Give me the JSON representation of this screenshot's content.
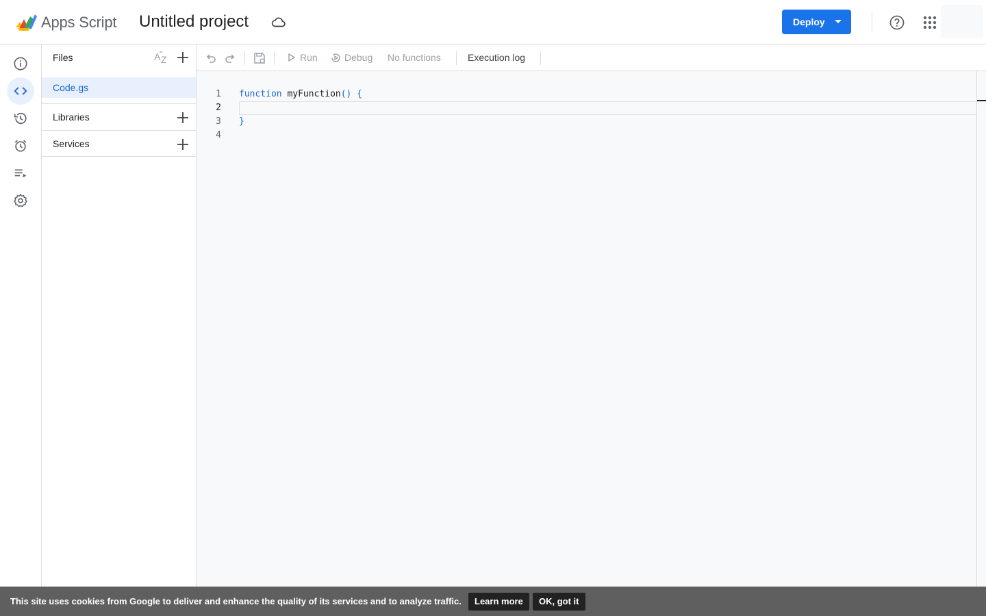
{
  "header": {
    "app_name": "Apps Script",
    "project_title": "Untitled project",
    "deploy_label": "Deploy"
  },
  "files_panel": {
    "title": "Files",
    "files": [
      {
        "name": "Code.gs",
        "selected": true
      }
    ],
    "sections": [
      {
        "label": "Libraries"
      },
      {
        "label": "Services"
      }
    ]
  },
  "toolbar": {
    "run_label": "Run",
    "debug_label": "Debug",
    "function_select": "No functions",
    "execution_log_label": "Execution log"
  },
  "editor": {
    "current_line": 2,
    "lines": [
      {
        "number": "1",
        "keyword": "function",
        "name": " myFunction",
        "rest": "() {"
      },
      {
        "number": "2",
        "keyword": "",
        "name": "",
        "rest": ""
      },
      {
        "number": "3",
        "keyword": "",
        "name": "",
        "rest": "}"
      },
      {
        "number": "4",
        "keyword": "",
        "name": "",
        "rest": ""
      }
    ]
  },
  "cookie_banner": {
    "text": "This site uses cookies from Google to deliver and enhance the quality of its services and to analyze traffic.",
    "learn_more": "Learn more",
    "ok": "OK, got it"
  },
  "icons": {
    "rail": [
      "info-icon",
      "code-icon",
      "history-icon",
      "alarm-icon",
      "executions-icon",
      "settings-icon"
    ],
    "active_rail": "code-icon"
  },
  "colors": {
    "accent": "#1a73e8",
    "selected_bg": "#e8f0fe",
    "cookie_bg": "#5f5f5f"
  }
}
